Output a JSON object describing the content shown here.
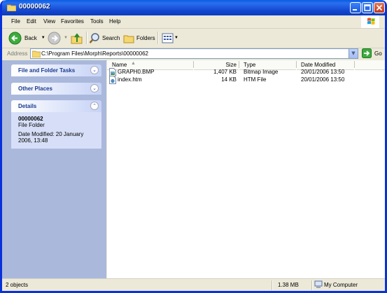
{
  "window": {
    "title": "00000062"
  },
  "menu": [
    "File",
    "Edit",
    "View",
    "Favorites",
    "Tools",
    "Help"
  ],
  "toolbar": {
    "back_label": "Back",
    "search_label": "Search",
    "folders_label": "Folders"
  },
  "address": {
    "label": "Address",
    "path": "C:\\Program Files\\Morph\\Reports\\00000062",
    "go_label": "Go"
  },
  "tasks": {
    "file_folder_tasks": "File and Folder Tasks",
    "other_places": "Other Places",
    "details": "Details"
  },
  "details": {
    "name": "00000062",
    "type": "File Folder",
    "modified_line1": "Date Modified: 20 January",
    "modified_line2": "2006, 13:48"
  },
  "columns": {
    "name": "Name",
    "size": "Size",
    "type": "Type",
    "date": "Date Modified"
  },
  "files": [
    {
      "name": "GRAPH0.BMP",
      "size": "1,407 KB",
      "type": "Bitmap Image",
      "date": "20/01/2006 13:50",
      "icon": "bitmap-file-icon"
    },
    {
      "name": "index.htm",
      "size": "14 KB",
      "type": "HTM File",
      "date": "20/01/2006 13:50",
      "icon": "html-file-icon"
    }
  ],
  "status": {
    "objects": "2 objects",
    "size": "1.38 MB",
    "location": "My Computer"
  }
}
